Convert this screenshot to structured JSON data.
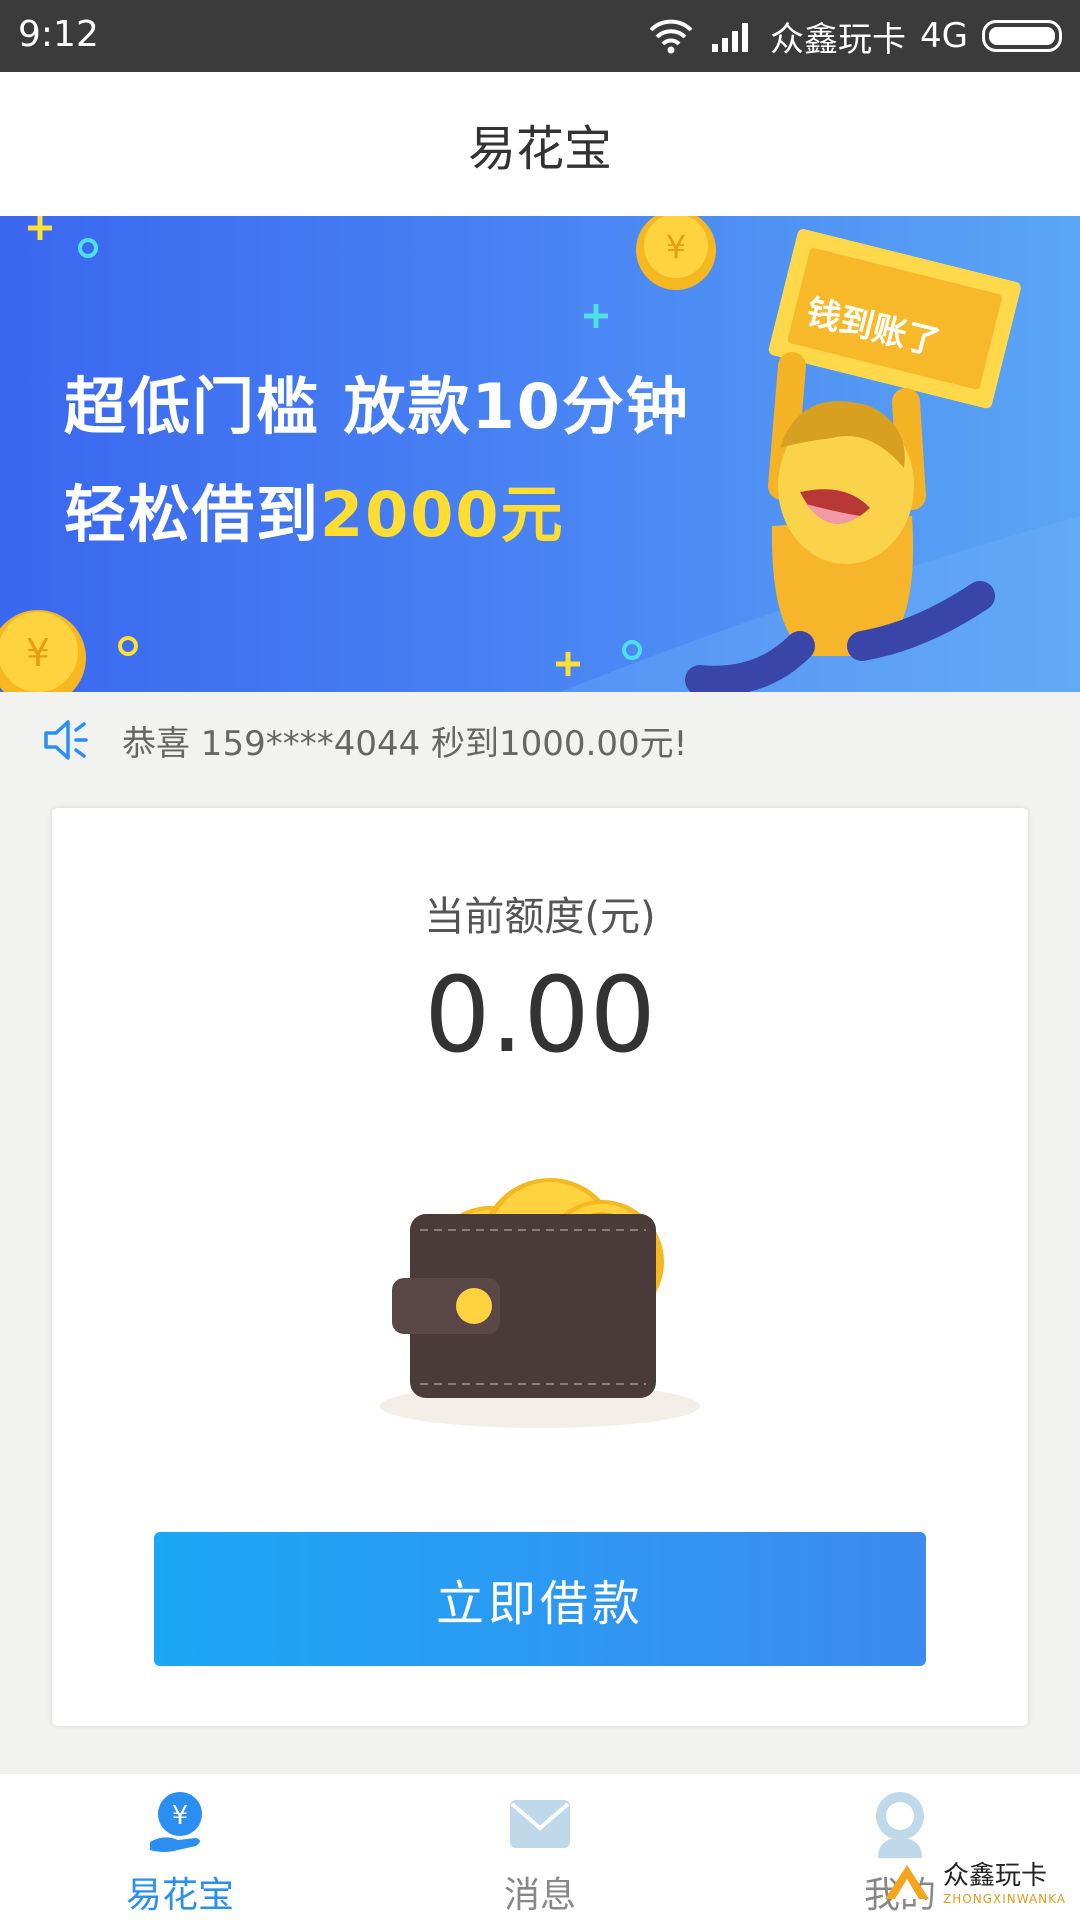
{
  "status_bar": {
    "time": "9:12",
    "carrier": "众鑫玩卡",
    "network": "4G"
  },
  "header": {
    "title": "易花宝"
  },
  "banner": {
    "line1": "超低门槛  放款10分钟",
    "line2_prefix": "轻松借到",
    "line2_amount": "2000元",
    "sign_text": "钱到账了"
  },
  "notice": {
    "text": "恭喜 159****4044 秒到1000.00元!"
  },
  "card": {
    "quota_label": "当前额度(元)",
    "quota_value": "0.00",
    "borrow_button": "立即借款"
  },
  "bottom_nav": {
    "items": [
      {
        "label": "易花宝",
        "icon": "yen-hand-icon",
        "active": true
      },
      {
        "label": "消息",
        "icon": "envelope-icon",
        "active": false
      },
      {
        "label": "我的",
        "icon": "user-icon",
        "active": false
      }
    ]
  },
  "watermark": {
    "title": "众鑫玩卡",
    "subtitle": "ZHONGXINWANKA"
  },
  "colors": {
    "accent": "#2a8ff0",
    "banner_highlight": "#ffdd33",
    "button_start": "#1aa7f4",
    "button_end": "#3d8bf0"
  }
}
